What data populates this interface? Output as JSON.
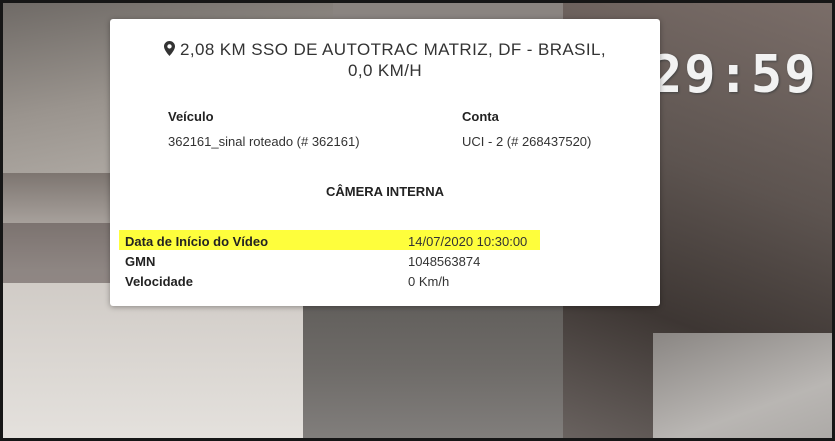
{
  "video": {
    "timestamp_overlay": "29:59"
  },
  "popup": {
    "location_title": "2,08 KM SSO DE AUTOTRAC MATRIZ, DF - BRASIL, 0,0 KM/H",
    "pin_icon": "map-marker-icon",
    "vehicle": {
      "label": "Veículo",
      "value": "362161_sinal roteado (# 362161)"
    },
    "account": {
      "label": "Conta",
      "value": "UCI - 2 (# 268437520)"
    },
    "section_title": "CÂMERA INTERNA",
    "details": [
      {
        "label": "Data de Início do Vídeo",
        "value": "14/07/2020 10:30:00",
        "highlighted": true
      },
      {
        "label": "GMN",
        "value": "1048563874",
        "highlighted": false
      },
      {
        "label": "Velocidade",
        "value": "0 Km/h",
        "highlighted": false
      }
    ],
    "highlight_color": "#fefe3c"
  }
}
